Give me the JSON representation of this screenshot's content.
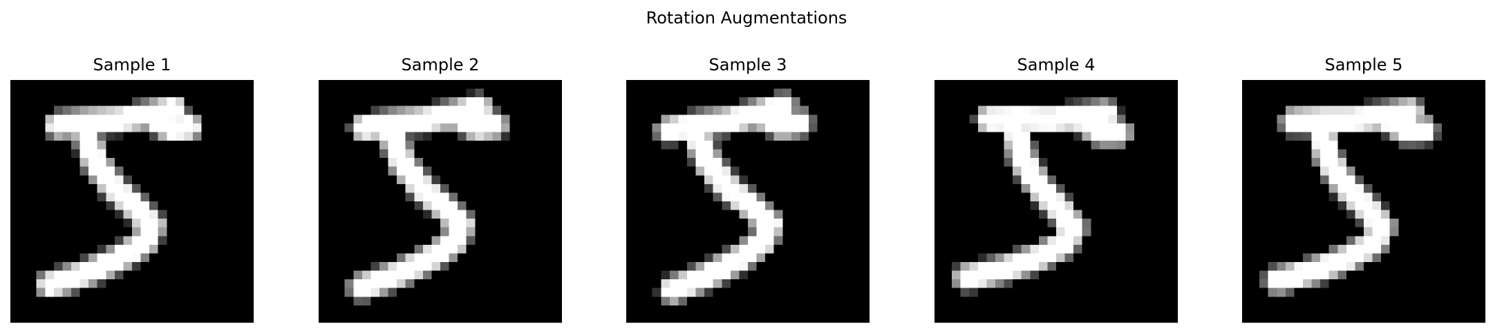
{
  "figure": {
    "title": "Rotation Augmentations"
  },
  "panels": [
    {
      "title": "Sample 1",
      "rotation_deg": 0
    },
    {
      "title": "Sample 2",
      "rotation_deg": -2
    },
    {
      "title": "Sample 3",
      "rotation_deg": -4
    },
    {
      "title": "Sample 4",
      "rotation_deg": 5
    },
    {
      "title": "Sample 5",
      "rotation_deg": 3
    }
  ],
  "colors": {
    "background": "#000000",
    "foreground": "#ffffff"
  }
}
